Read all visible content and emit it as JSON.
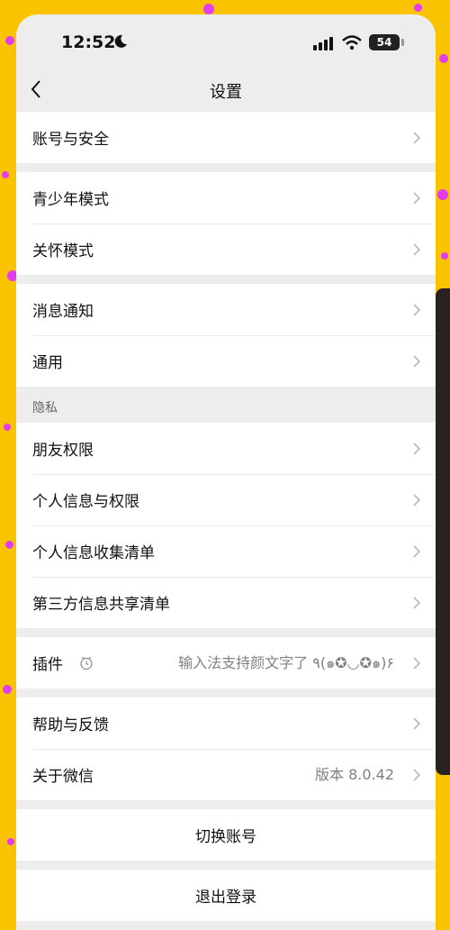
{
  "status": {
    "time": "12:52",
    "battery": "54"
  },
  "nav": {
    "title": "设置"
  },
  "groups": {
    "g1": [
      "账号与安全"
    ],
    "g2": [
      "青少年模式",
      "关怀模式"
    ],
    "g3": [
      "消息通知",
      "通用"
    ],
    "privacy": {
      "section": "隐私",
      "items": [
        "朋友权限",
        "个人信息与权限",
        "个人信息收集清单",
        "第三方信息共享清单"
      ]
    },
    "plugins": {
      "label": "插件",
      "value": "输入法支持颜文字了 ٩(๑✪◡✪๑)۶"
    },
    "help": {
      "feedback": "帮助与反馈",
      "about": "关于微信",
      "version": "版本 8.0.42"
    }
  },
  "actions": {
    "switch_account": "切换账号",
    "logout": "退出登录"
  },
  "colors": {
    "background": "#f9c300",
    "dots": "#e23cf0",
    "screen_bg": "#ededed"
  }
}
